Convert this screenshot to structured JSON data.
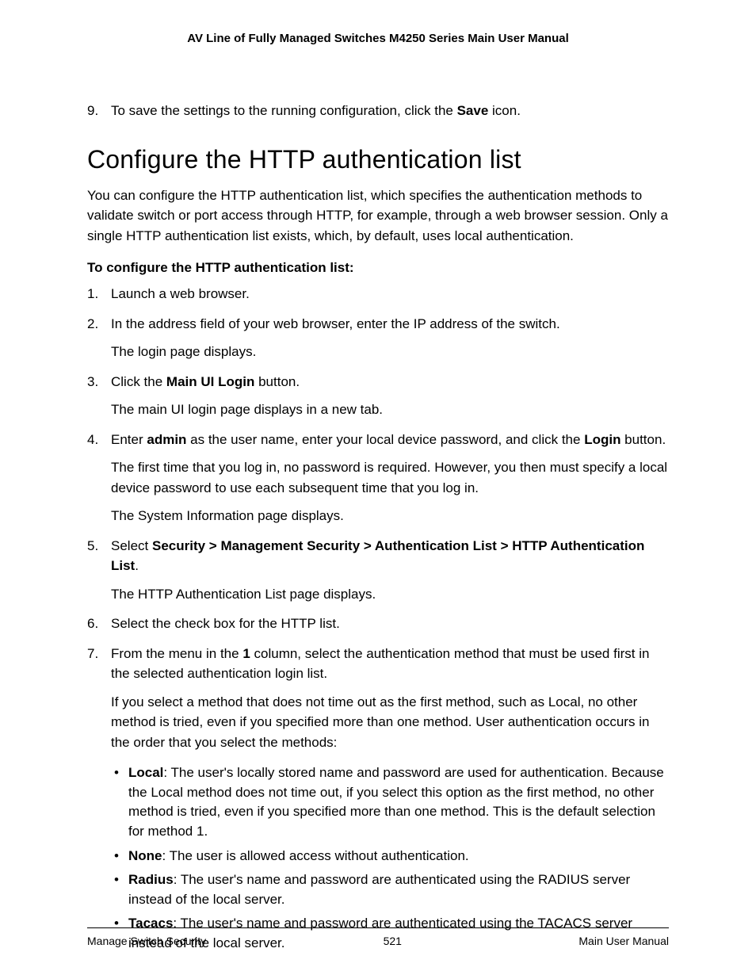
{
  "header": "AV Line of Fully Managed Switches M4250 Series Main User Manual",
  "pre_step": {
    "num": "9.",
    "parts": [
      "To save the settings to the running configuration, click the ",
      "Save",
      " icon."
    ]
  },
  "section_title": "Configure the HTTP authentication list",
  "intro": "You can configure the HTTP authentication list, which specifies the authentication methods to validate switch or port access through HTTP, for example, through a web browser session. Only a single HTTP authentication list exists, which, by default, uses local authentication.",
  "sub_heading": "To configure the HTTP authentication list:",
  "steps": {
    "s1": {
      "num": "1.",
      "text": "Launch a web browser."
    },
    "s2": {
      "num": "2.",
      "l1": "In the address field of your web browser, enter the IP address of the switch.",
      "l2": "The login page displays."
    },
    "s3": {
      "num": "3.",
      "l1a": "Click the ",
      "l1b": "Main UI Login",
      "l1c": " button.",
      "l2": "The main UI login page displays in a new tab."
    },
    "s4": {
      "num": "4.",
      "l1a": "Enter ",
      "l1b": "admin",
      "l1c": " as the user name, enter your local device password, and click the ",
      "l1d": "Login",
      "l1e": " button.",
      "l2": "The first time that you log in, no password is required. However, you then must specify a local device password to use each subsequent time that you log in.",
      "l3": "The System Information page displays."
    },
    "s5": {
      "num": "5.",
      "l1a": "Select ",
      "l1b": "Security > Management Security > Authentication List > HTTP Authentication List",
      "l1c": ".",
      "l2": "The HTTP Authentication List page displays."
    },
    "s6": {
      "num": "6.",
      "text": "Select the check box for the HTTP list."
    },
    "s7": {
      "num": "7.",
      "l1a": "From the menu in the ",
      "l1b": "1",
      "l1c": " column, select the authentication method that must be used first in the selected authentication login list.",
      "l2": "If you select a method that does not time out as the first method, such as Local, no other method is tried, even if you specified more than one method. User authentication occurs in the order that you select the methods:",
      "bullets": {
        "b1": {
          "label": "Local",
          "text": ": The user's locally stored name and password are used for authentication. Because the Local method does not time out, if you select this option as the first method, no other method is tried, even if you specified more than one method. This is the default selection for method 1."
        },
        "b2": {
          "label": "None",
          "text": ": The user is allowed access without authentication."
        },
        "b3": {
          "label": "Radius",
          "text": ": The user's name and password are authenticated using the RADIUS server instead of the local server."
        },
        "b4": {
          "label": "Tacacs",
          "text": ": The user's name and password are authenticated using the TACACS server instead of the local server."
        }
      }
    }
  },
  "footer": {
    "left": "Manage Switch Security",
    "center": "521",
    "right": "Main User Manual"
  }
}
